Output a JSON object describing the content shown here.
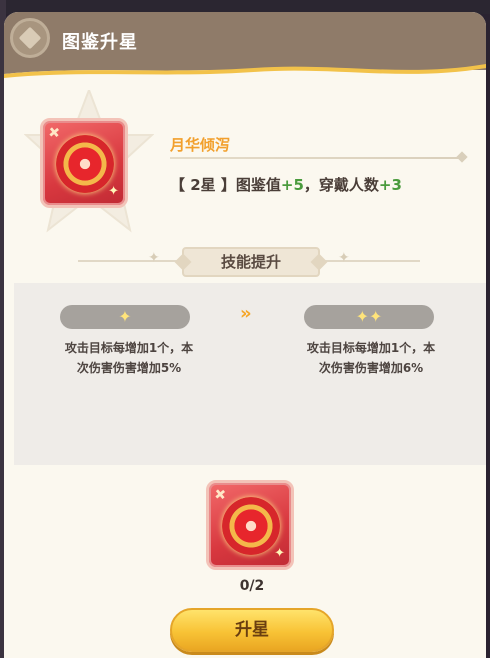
{
  "header": {
    "title": "图鉴升星"
  },
  "item": {
    "name": "月华倾泻",
    "bonus_prefix": "【 2星 】图鉴值",
    "bonus_value_1": "+5",
    "bonus_mid": "，穿戴人数",
    "bonus_value_2": "+3"
  },
  "section": {
    "title": "技能提升"
  },
  "compare": {
    "current_stars": "✦",
    "next_stars": "✦✦",
    "arrow": "»",
    "current_desc_line1": "攻击目标每增加1个，本",
    "current_desc_line2": "次伤害伤害增加5%",
    "next_desc_line1": "攻击目标每增加1个，本",
    "next_desc_line2": "次伤害伤害增加6%"
  },
  "material": {
    "count": "0/2"
  },
  "button": {
    "upgrade_label": "升星"
  },
  "colors": {
    "accent_orange": "#f2a02d",
    "plus_green": "#4a9b3d",
    "button_yellow": "#f8c336",
    "header_brown": "#8f7b69"
  },
  "icons": [
    "emblem-icon",
    "item-card-icon",
    "star-icon",
    "double-arrow-icon",
    "sparkle-icon"
  ]
}
